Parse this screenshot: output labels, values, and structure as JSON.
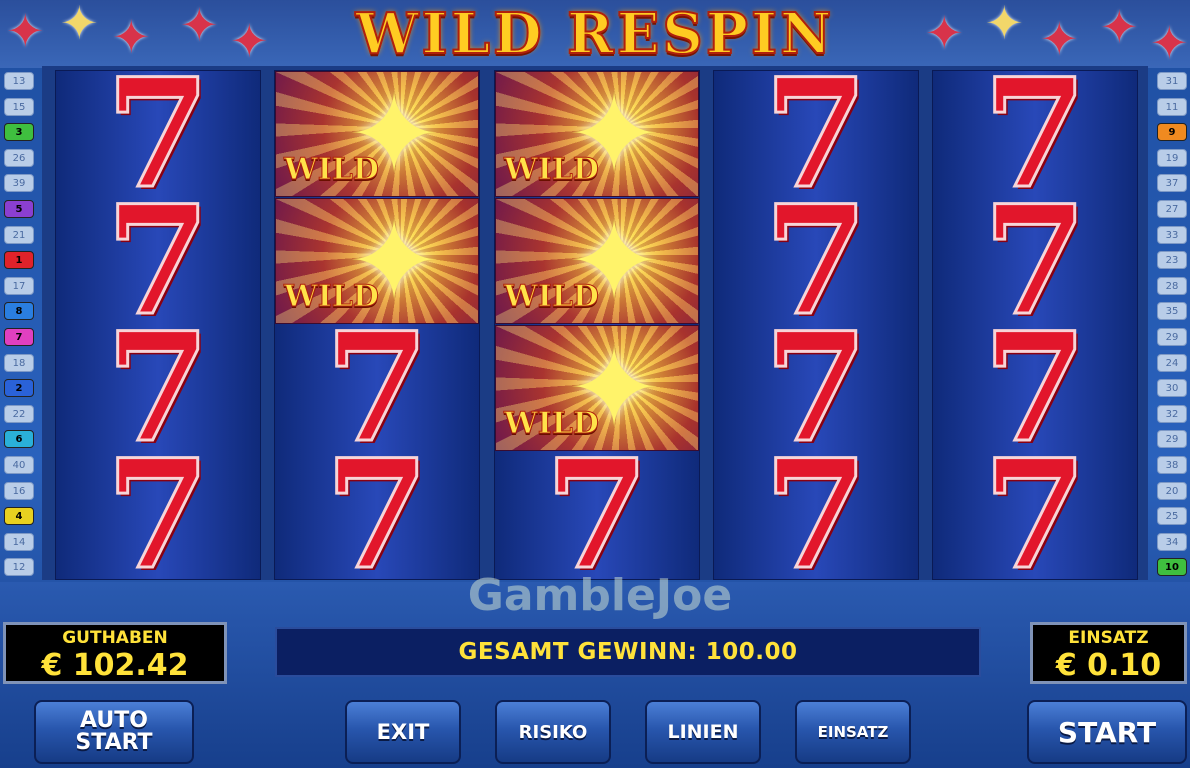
{
  "game": {
    "title": "WILD RESPIN",
    "watermark": "GambleJoe"
  },
  "reels": [
    [
      "7",
      "7",
      "7",
      "7"
    ],
    [
      "WILD",
      "WILD",
      "7",
      "7"
    ],
    [
      "WILD",
      "WILD",
      "WILD",
      "7"
    ],
    [
      "7",
      "7",
      "7",
      "7"
    ],
    [
      "7",
      "7",
      "7",
      "7"
    ]
  ],
  "wild_label": "WILD",
  "paylines_left": [
    {
      "n": "13",
      "active": false,
      "color": ""
    },
    {
      "n": "15",
      "active": false,
      "color": ""
    },
    {
      "n": "3",
      "active": true,
      "color": "#3fbf3f"
    },
    {
      "n": "26",
      "active": false,
      "color": ""
    },
    {
      "n": "39",
      "active": false,
      "color": ""
    },
    {
      "n": "5",
      "active": true,
      "color": "#8a3fd0"
    },
    {
      "n": "21",
      "active": false,
      "color": ""
    },
    {
      "n": "1",
      "active": true,
      "color": "#e0222a"
    },
    {
      "n": "17",
      "active": false,
      "color": ""
    },
    {
      "n": "8",
      "active": true,
      "color": "#2a7ee0"
    },
    {
      "n": "7",
      "active": true,
      "color": "#e040c0"
    },
    {
      "n": "18",
      "active": false,
      "color": ""
    },
    {
      "n": "2",
      "active": true,
      "color": "#2a62d8"
    },
    {
      "n": "22",
      "active": false,
      "color": ""
    },
    {
      "n": "6",
      "active": true,
      "color": "#2ab0d8"
    },
    {
      "n": "40",
      "active": false,
      "color": ""
    },
    {
      "n": "16",
      "active": false,
      "color": ""
    },
    {
      "n": "4",
      "active": true,
      "color": "#e8d020"
    },
    {
      "n": "14",
      "active": false,
      "color": ""
    },
    {
      "n": "12",
      "active": false,
      "color": ""
    }
  ],
  "paylines_right": [
    {
      "n": "31",
      "active": false,
      "color": ""
    },
    {
      "n": "11",
      "active": false,
      "color": ""
    },
    {
      "n": "9",
      "active": true,
      "color": "#f08a20"
    },
    {
      "n": "19",
      "active": false,
      "color": ""
    },
    {
      "n": "37",
      "active": false,
      "color": ""
    },
    {
      "n": "27",
      "active": false,
      "color": ""
    },
    {
      "n": "33",
      "active": false,
      "color": ""
    },
    {
      "n": "23",
      "active": false,
      "color": ""
    },
    {
      "n": "28",
      "active": false,
      "color": ""
    },
    {
      "n": "35",
      "active": false,
      "color": ""
    },
    {
      "n": "29",
      "active": false,
      "color": ""
    },
    {
      "n": "24",
      "active": false,
      "color": ""
    },
    {
      "n": "30",
      "active": false,
      "color": ""
    },
    {
      "n": "32",
      "active": false,
      "color": ""
    },
    {
      "n": "29",
      "active": false,
      "color": ""
    },
    {
      "n": "38",
      "active": false,
      "color": ""
    },
    {
      "n": "20",
      "active": false,
      "color": ""
    },
    {
      "n": "25",
      "active": false,
      "color": ""
    },
    {
      "n": "34",
      "active": false,
      "color": ""
    },
    {
      "n": "10",
      "active": true,
      "color": "#3fbf3f"
    }
  ],
  "balance": {
    "label": "GUTHABEN",
    "value": "€ 102.42"
  },
  "bet": {
    "label": "EINSATZ",
    "value": "€ 0.10"
  },
  "message": "GESAMT GEWINN: 100.00",
  "buttons": {
    "auto_start": "AUTO\nSTART",
    "exit": "EXIT",
    "risiko": "RISIKO",
    "linien": "LINIEN",
    "einsatz": "EINSATZ",
    "start": "START"
  }
}
